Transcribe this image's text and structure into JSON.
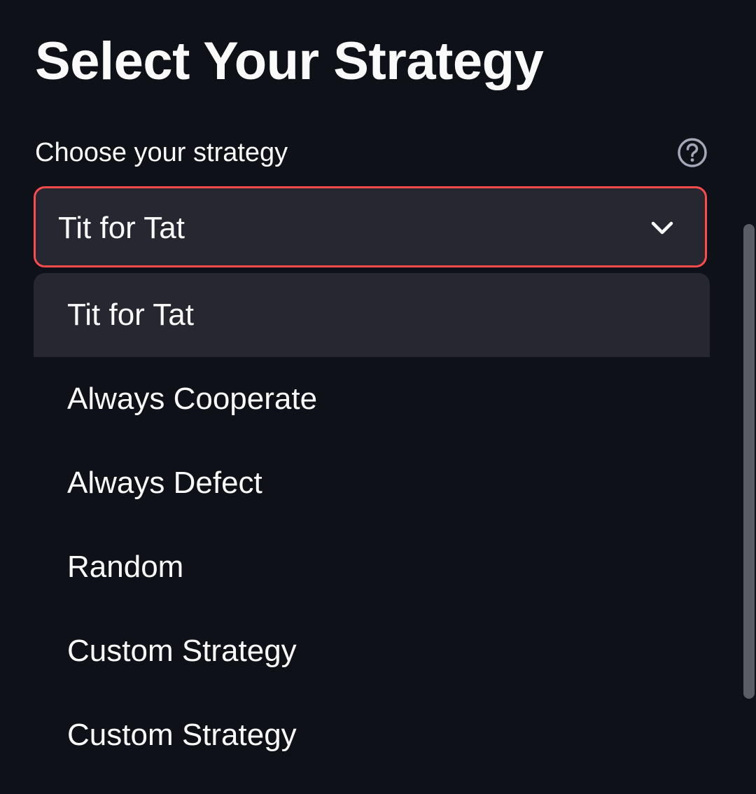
{
  "page": {
    "title": "Select Your Strategy"
  },
  "strategy_select": {
    "label": "Choose your strategy",
    "help_icon": "question-circle-icon",
    "selected_value": "Tit for Tat",
    "chevron_icon": "chevron-down-icon",
    "options": [
      {
        "label": "Tit for Tat",
        "selected": true
      },
      {
        "label": "Always Cooperate",
        "selected": false
      },
      {
        "label": "Always Defect",
        "selected": false
      },
      {
        "label": "Random",
        "selected": false
      },
      {
        "label": "Custom Strategy",
        "selected": false
      },
      {
        "label": "Custom Strategy",
        "selected": false
      }
    ]
  },
  "colors": {
    "background": "#0e1117",
    "input_background": "#262730",
    "focus_border": "#ff4b4b",
    "text": "#fafafa",
    "scrollbar": "#5a5c66"
  }
}
